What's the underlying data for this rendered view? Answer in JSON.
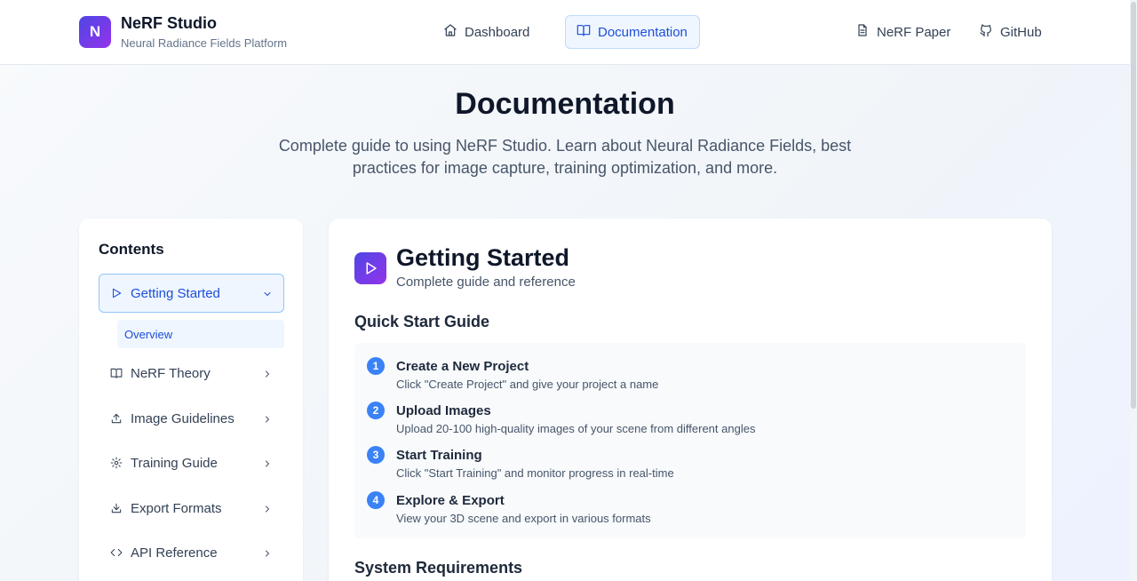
{
  "header": {
    "logo_letter": "N",
    "title": "NeRF Studio",
    "subtitle": "Neural Radiance Fields Platform",
    "nav": [
      {
        "label": "Dashboard",
        "icon": "home-icon"
      },
      {
        "label": "Documentation",
        "icon": "book-icon",
        "active": true
      }
    ],
    "links": [
      {
        "label": "NeRF Paper",
        "icon": "file-icon"
      },
      {
        "label": "GitHub",
        "icon": "github-icon"
      }
    ]
  },
  "hero": {
    "title": "Documentation",
    "subtitle": "Complete guide to using NeRF Studio. Learn about Neural Radiance Fields, best practices for image capture, training optimization, and more."
  },
  "sidebar": {
    "title": "Contents",
    "items": [
      {
        "label": "Getting Started",
        "icon": "play-icon",
        "active": true,
        "expanded": true
      },
      {
        "label": "NeRF Theory",
        "icon": "book-icon"
      },
      {
        "label": "Image Guidelines",
        "icon": "upload-icon"
      },
      {
        "label": "Training Guide",
        "icon": "gear-icon"
      },
      {
        "label": "Export Formats",
        "icon": "download-icon"
      },
      {
        "label": "API Reference",
        "icon": "code-icon"
      }
    ],
    "subitems": [
      {
        "label": "Overview",
        "active": true
      }
    ]
  },
  "main": {
    "section_icon": "play-icon",
    "title": "Getting Started",
    "subtitle": "Complete guide and reference",
    "quick_start_heading": "Quick Start Guide",
    "steps": [
      {
        "num": "1",
        "title": "Create a New Project",
        "desc": "Click \"Create Project\" and give your project a name"
      },
      {
        "num": "2",
        "title": "Upload Images",
        "desc": "Upload 20-100 high-quality images of your scene from different angles"
      },
      {
        "num": "3",
        "title": "Start Training",
        "desc": "Click \"Start Training\" and monitor progress in real-time"
      },
      {
        "num": "4",
        "title": "Explore & Export",
        "desc": "View your 3D scene and export in various formats"
      }
    ],
    "system_heading": "System Requirements"
  },
  "colors": {
    "accent": "#3b82f6",
    "accent_dark": "#1d4ed8",
    "brand_gradient_start": "#4f46e5",
    "brand_gradient_end": "#9333ea"
  }
}
